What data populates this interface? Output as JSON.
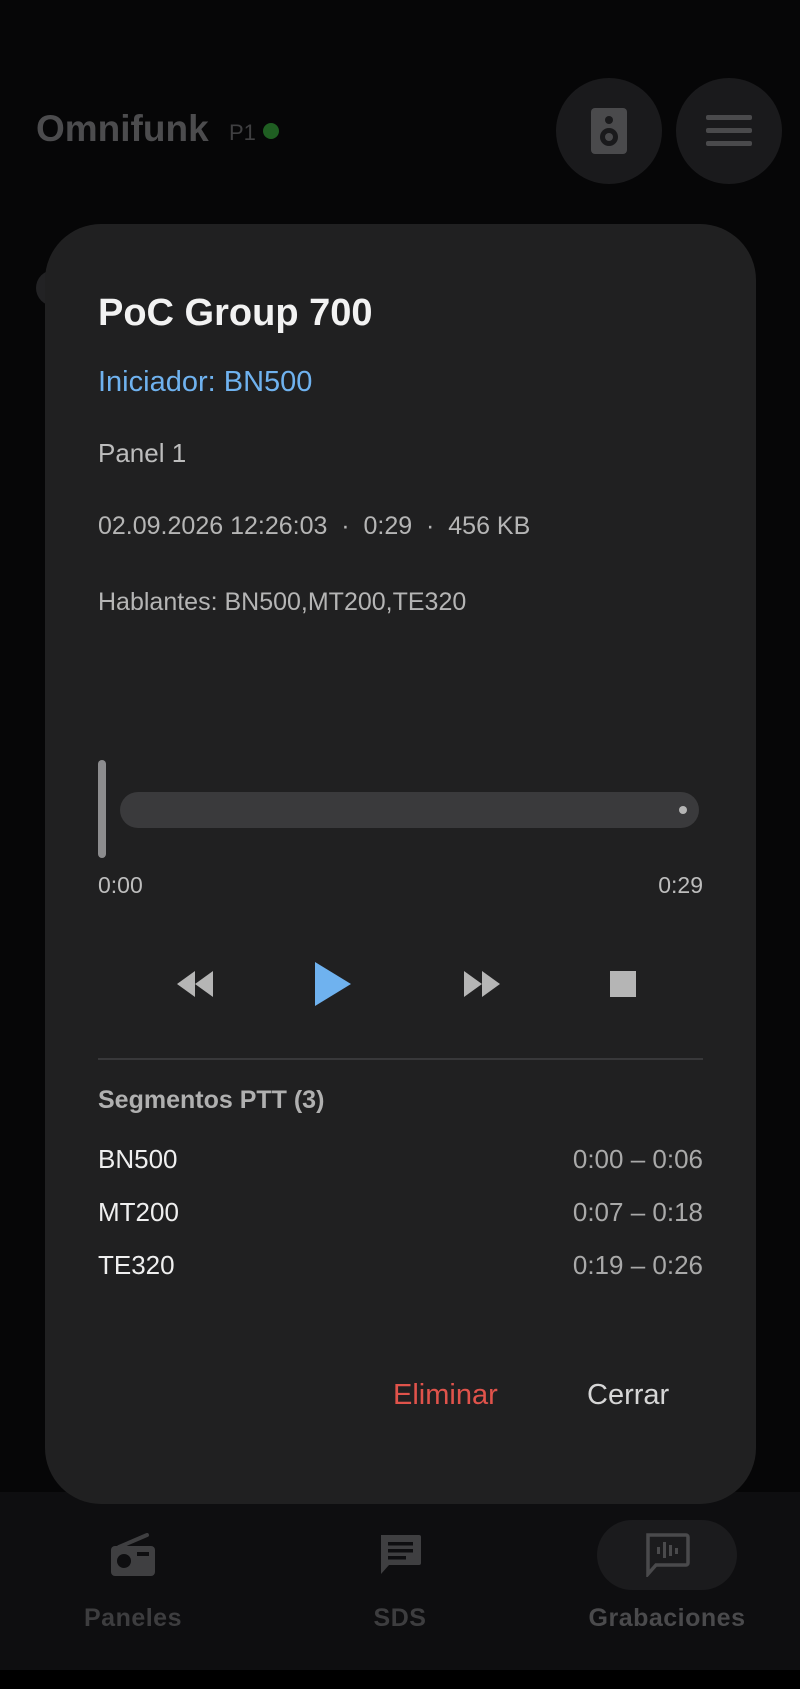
{
  "app": {
    "title": "Omnifunk",
    "panel_badge": "P1",
    "status_color": "#2e7d32"
  },
  "header_buttons": [
    {
      "icon": "speaker-icon"
    },
    {
      "icon": "hamburger-menu-icon"
    }
  ],
  "dialog": {
    "title": "PoC Group 700",
    "initiator": "Iniciador: BN500",
    "panel": "Panel 1",
    "meta": "02.09.2026 12:26:03  ·  0:29  ·  456 KB",
    "speakers": "Hablantes: BN500,MT200,TE320",
    "player": {
      "position_label": "0:00",
      "duration_label": "0:29",
      "progress": 0.0,
      "controls": [
        "rewind-icon",
        "play-icon",
        "fast-forward-icon",
        "stop-icon"
      ]
    },
    "segments_heading": "Segmentos PTT (3)",
    "segments": [
      {
        "speaker": "BN500",
        "range": "0:00 – 0:06"
      },
      {
        "speaker": "MT200",
        "range": "0:07 – 0:18"
      },
      {
        "speaker": "TE320",
        "range": "0:19 – 0:26"
      }
    ],
    "actions": {
      "delete_label": "Eliminar",
      "close_label": "Cerrar"
    }
  },
  "bottom_nav": [
    {
      "label": "Paneles",
      "icon": "radio-icon",
      "active": false
    },
    {
      "label": "SDS",
      "icon": "message-icon",
      "active": false
    },
    {
      "label": "Grabaciones",
      "icon": "voice-recording-icon",
      "active": true
    }
  ],
  "colors": {
    "accent": "#6fb2ef",
    "danger": "#e0534b",
    "dialog_bg": "#202021"
  }
}
